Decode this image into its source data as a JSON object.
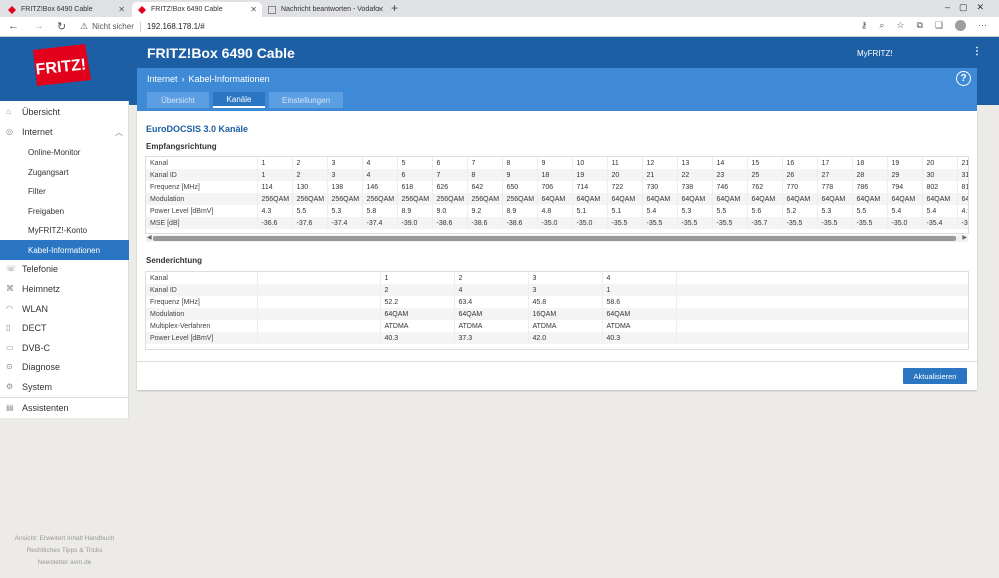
{
  "browser": {
    "tabs": [
      {
        "label": "FRITZ!Box 6490 Cable"
      },
      {
        "label": "FRITZ!Box 6490 Cable"
      },
      {
        "label": "Nachricht beantworten - Vodafo"
      }
    ],
    "not_secure": "Nicht sicher",
    "url": "192.168.178.1/#"
  },
  "header": {
    "title": "FRITZ!Box 6490 Cable",
    "myfritz": "MyFRITZ!",
    "logo_text": "FRITZ!"
  },
  "subheader": {
    "crumb1": "Internet",
    "crumb_sep": "›",
    "crumb2": "Kabel-Informationen",
    "help": "?",
    "tabs": [
      {
        "label": "Übersicht"
      },
      {
        "label": "Kanäle"
      },
      {
        "label": "Einstellungen"
      }
    ]
  },
  "sidebar": {
    "items": [
      {
        "label": "Übersicht"
      },
      {
        "label": "Internet"
      },
      {
        "label": "Online-Monitor"
      },
      {
        "label": "Zugangsart"
      },
      {
        "label": "Filter"
      },
      {
        "label": "Freigaben"
      },
      {
        "label": "MyFRITZ!-Konto"
      },
      {
        "label": "Kabel-Informationen"
      },
      {
        "label": "Telefonie"
      },
      {
        "label": "Heimnetz"
      },
      {
        "label": "WLAN"
      },
      {
        "label": "DECT"
      },
      {
        "label": "DVB-C"
      },
      {
        "label": "Diagnose"
      },
      {
        "label": "System"
      },
      {
        "label": "Assistenten"
      }
    ],
    "footer1": "Ansicht: Erweitert   Inhalt   Handbuch",
    "footer2": "Rechtliches   Tipps & Tricks",
    "footer3": "Newsletter   avm.de"
  },
  "content": {
    "title": "EuroDOCSIS 3.0 Kanäle",
    "downstream": {
      "heading": "Empfangsrichtung",
      "rows": [
        [
          "Kanal",
          "1",
          "2",
          "3",
          "4",
          "5",
          "6",
          "7",
          "8",
          "9",
          "10",
          "11",
          "12",
          "13",
          "14",
          "15",
          "16",
          "17",
          "18",
          "19",
          "20",
          "21"
        ],
        [
          "Kanal ID",
          "1",
          "2",
          "3",
          "4",
          "6",
          "7",
          "8",
          "9",
          "18",
          "19",
          "20",
          "21",
          "22",
          "23",
          "25",
          "26",
          "27",
          "28",
          "29",
          "30",
          "31"
        ],
        [
          "Frequenz [MHz]",
          "114",
          "130",
          "138",
          "146",
          "618",
          "626",
          "642",
          "650",
          "706",
          "714",
          "722",
          "730",
          "738",
          "746",
          "762",
          "770",
          "778",
          "786",
          "794",
          "802",
          "810"
        ],
        [
          "Modulation",
          "256QAM",
          "256QAM",
          "256QAM",
          "256QAM",
          "256QAM",
          "256QAM",
          "256QAM",
          "256QAM",
          "64QAM",
          "64QAM",
          "64QAM",
          "64QAM",
          "64QAM",
          "64QAM",
          "64QAM",
          "64QAM",
          "64QAM",
          "64QAM",
          "64QAM",
          "64QAM",
          "64QAM"
        ],
        [
          "Power Level [dBmV]",
          "4.3",
          "5.5",
          "5.3",
          "5.8",
          "8.9",
          "9.0",
          "9.2",
          "8.9",
          "4.8",
          "5.1",
          "5.1",
          "5.4",
          "5.3",
          "5.5",
          "5.6",
          "5.2",
          "5.3",
          "5.5",
          "5.4",
          "5.4",
          "4.9"
        ],
        [
          "MSE [dB]",
          "-36.6",
          "-37.6",
          "-37.4",
          "-37.4",
          "-39.0",
          "-38.6",
          "-38.6",
          "-38.6",
          "-35.0",
          "-35.0",
          "-35.5",
          "-35.5",
          "-35.5",
          "-35.5",
          "-35.7",
          "-35.5",
          "-35.5",
          "-35.5",
          "-35.0",
          "-35.4",
          "-35.5"
        ]
      ]
    },
    "upstream": {
      "heading": "Senderichtung",
      "rows": [
        [
          "Kanal",
          "",
          "1",
          "2",
          "3",
          "4",
          ""
        ],
        [
          "Kanal ID",
          "",
          "2",
          "4",
          "3",
          "1",
          ""
        ],
        [
          "Frequenz [MHz]",
          "",
          "52.2",
          "63.4",
          "45.8",
          "58.6",
          ""
        ],
        [
          "Modulation",
          "",
          "64QAM",
          "64QAM",
          "16QAM",
          "64QAM",
          ""
        ],
        [
          "Multiplex-Verfahren",
          "",
          "ATDMA",
          "ATDMA",
          "ATDMA",
          "ATDMA",
          ""
        ],
        [
          "Power Level [dBmV]",
          "",
          "40.3",
          "37.3",
          "42.0",
          "40.3",
          ""
        ]
      ]
    },
    "refresh_button": "Aktualisieren"
  },
  "colors": {
    "brand": "#1d5fa4",
    "accent": "#2b76c3",
    "subheader": "#3f8ad6"
  }
}
